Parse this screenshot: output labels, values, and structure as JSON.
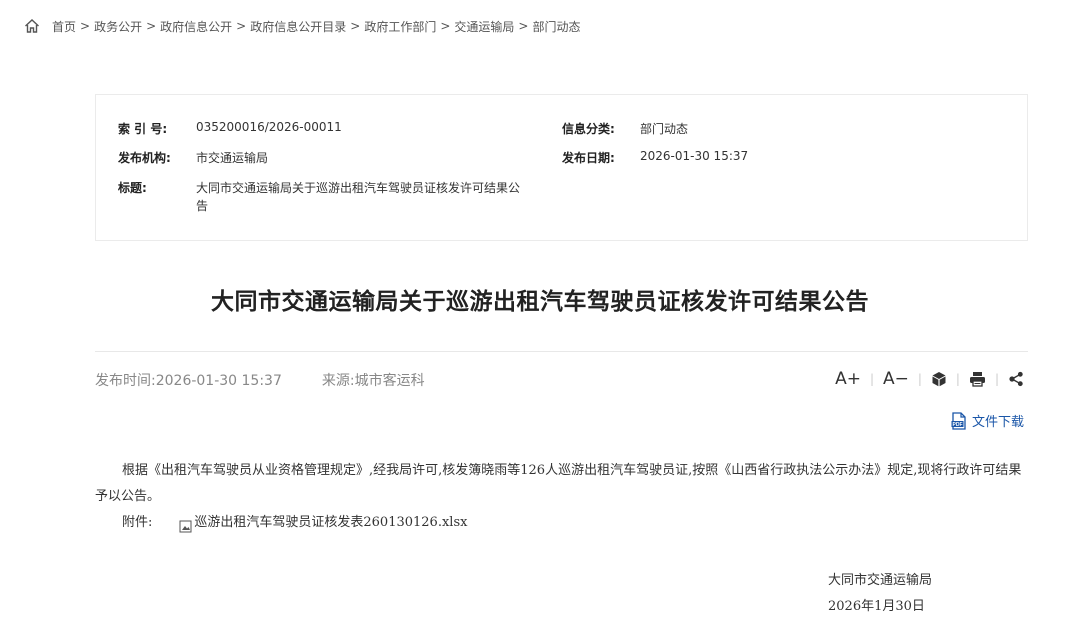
{
  "breadcrumb": {
    "items": [
      "首页",
      "政务公开",
      "政府信息公开",
      "政府信息公开目录",
      "政府工作部门",
      "交通运输局",
      "部门动态"
    ],
    "separator": ">"
  },
  "info": {
    "index_label": "索 引 号:",
    "index_value": "035200016/2026-00011",
    "category_label": "信息分类:",
    "category_value": "部门动态",
    "publisher_label": "发布机构:",
    "publisher_value": "市交通运输局",
    "date_label": "发布日期:",
    "date_value": "2026-01-30 15:37",
    "title_label": "标题:",
    "title_value": "大同市交通运输局关于巡游出租汽车驾驶员证核发许可结果公告"
  },
  "article": {
    "title": "大同市交通运输局关于巡游出租汽车驾驶员证核发许可结果公告",
    "publish_time": "发布时间:2026-01-30 15:37",
    "source": "来源:城市客运科",
    "body": "根据《出租汽车驾驶员从业资格管理规定》,经我局许可,核发簿晓雨等126人巡游出租汽车驾驶员证,按照《山西省行政执法公示办法》规定,现将行政许可结果予以公告。",
    "attachment_label": "附件:",
    "attachment_file": "巡游出租汽车驾驶员证核发表260130126.xlsx",
    "sign_org": "大同市交通运输局",
    "sign_date": "2026年1月30日"
  },
  "tools": {
    "font_larger": "A+",
    "font_smaller": "A−",
    "separator": "|",
    "download_label": "文件下载"
  },
  "colors": {
    "link_blue": "#1a56a8",
    "meta_gray": "#888888",
    "border": "#ebebeb"
  }
}
